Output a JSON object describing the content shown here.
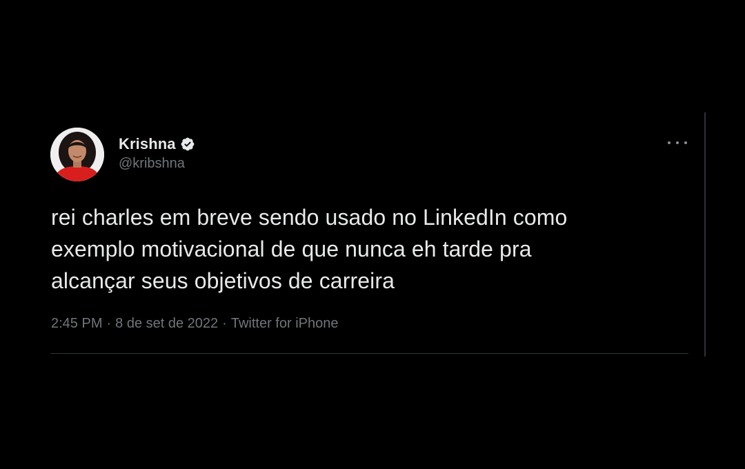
{
  "tweet": {
    "author": {
      "display_name": "Krishna",
      "handle": "@kribshna",
      "verified": true,
      "avatar_icon": "profile-photo",
      "verified_icon": "verified-badge-icon"
    },
    "text_lines": [
      "rei charles em breve sendo usado no LinkedIn como",
      "exemplo motivacional de que nunca eh tarde pra",
      "alcançar seus objetivos de carreira"
    ],
    "meta": {
      "time": "2:45 PM",
      "separator": "·",
      "date": "8 de set de 2022",
      "source": "Twitter for iPhone"
    },
    "more_icon": "more-horizontal-icon"
  },
  "colors": {
    "background": "#000000",
    "text_primary": "#e7e9ea",
    "text_secondary": "#71767b",
    "divider": "#2f3336",
    "verified_badge": "#e7e9ea"
  }
}
